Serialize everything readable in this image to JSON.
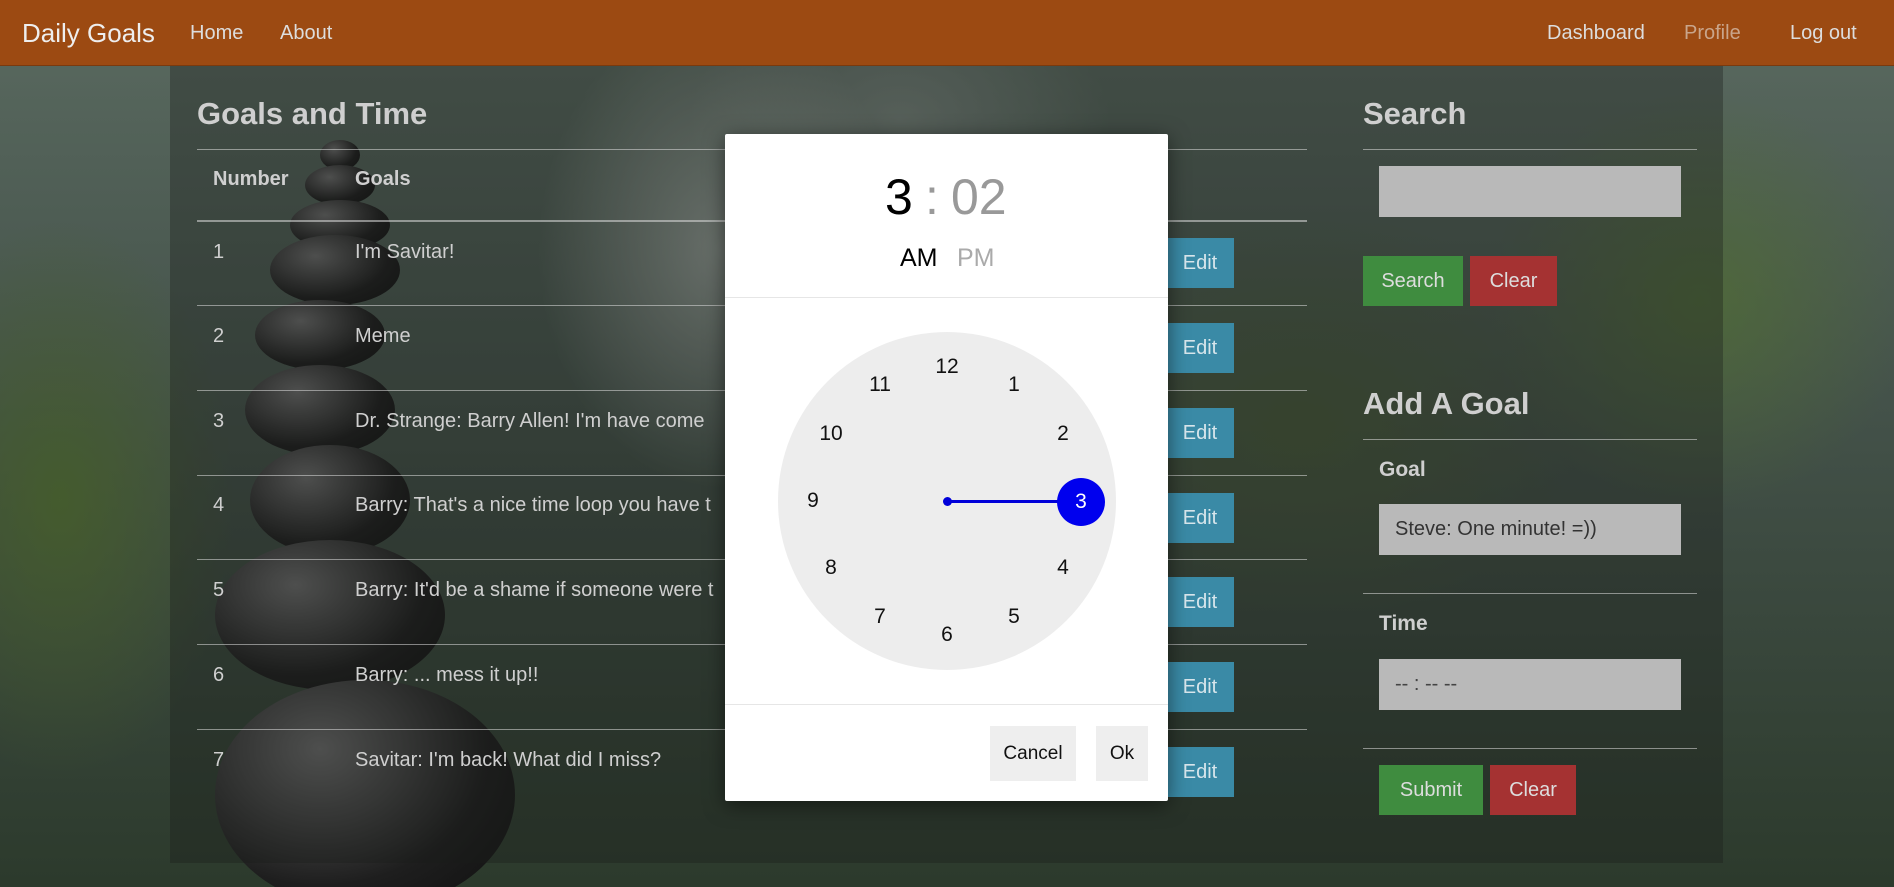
{
  "navbar": {
    "brand": "Daily Goals",
    "links": {
      "home": "Home",
      "about": "About",
      "dashboard": "Dashboard",
      "profile": "Profile",
      "logout": "Log out"
    }
  },
  "goals_table": {
    "title": "Goals and Time",
    "headers": {
      "number": "Number",
      "goals": "Goals"
    },
    "rows": [
      {
        "number": "1",
        "goal": "I'm Savitar!",
        "action": "Edit"
      },
      {
        "number": "2",
        "goal": "Meme",
        "action": "Edit"
      },
      {
        "number": "3",
        "goal": "Dr. Strange: Barry Allen! I'm have come",
        "action": "Edit"
      },
      {
        "number": "4",
        "goal": "Barry: That's a nice time loop you have t",
        "action": "Edit"
      },
      {
        "number": "5",
        "goal": "Barry: It'd be a shame if someone were t",
        "action": "Edit"
      },
      {
        "number": "6",
        "goal": "Barry: ... mess it up!!",
        "action": "Edit"
      },
      {
        "number": "7",
        "goal": "Savitar: I'm back! What did I miss?",
        "action": "Edit"
      }
    ]
  },
  "search": {
    "title": "Search",
    "input_value": "",
    "search_label": "Search",
    "clear_label": "Clear"
  },
  "add_goal": {
    "title": "Add A Goal",
    "goal_label": "Goal",
    "goal_value": "Steve: One minute! =))",
    "time_label": "Time",
    "time_value": "-- : --  --",
    "submit_label": "Submit",
    "clear_label": "Clear"
  },
  "time_picker": {
    "hour": "3",
    "separator": ":",
    "minute": "02",
    "am": "AM",
    "pm": "PM",
    "selected_period": "AM",
    "selected_hour": "3",
    "dial_numbers": [
      "12",
      "1",
      "2",
      "3",
      "4",
      "5",
      "6",
      "7",
      "8",
      "9",
      "10",
      "11"
    ],
    "cancel_label": "Cancel",
    "ok_label": "Ok",
    "accent_color": "#0000ee"
  }
}
